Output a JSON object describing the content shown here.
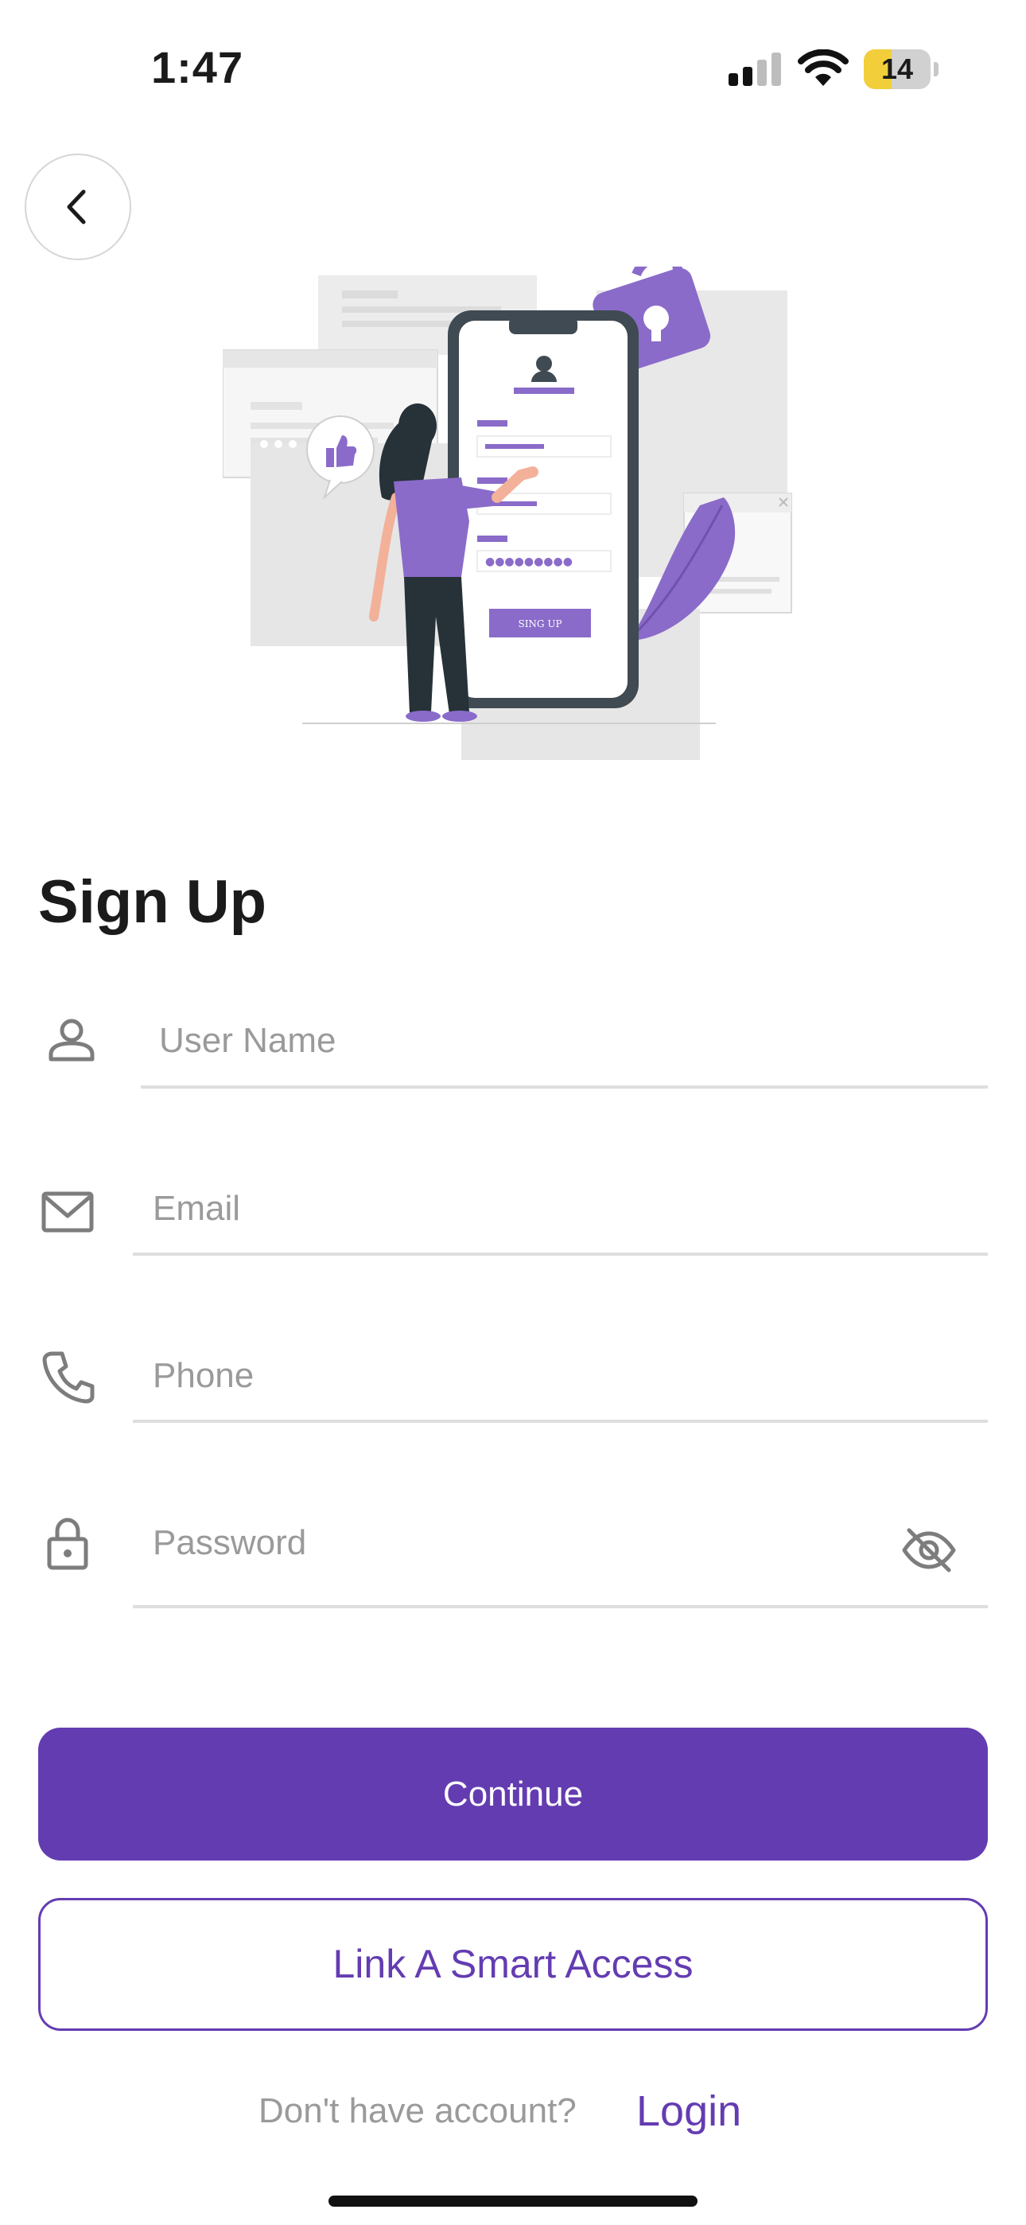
{
  "status_bar": {
    "time": "1:47",
    "battery_percent": "14",
    "battery_level": 0.14,
    "icons": [
      "cellular-signal-icon",
      "wifi-icon",
      "battery-icon"
    ]
  },
  "header": {
    "back_icon": "chevron-left-icon"
  },
  "illustration": {
    "button_text": "SING UP"
  },
  "title": "Sign Up",
  "form": {
    "username": {
      "placeholder": "User Name",
      "icon": "user-icon"
    },
    "email": {
      "placeholder": "Email",
      "icon": "mail-icon"
    },
    "phone": {
      "placeholder": "Phone",
      "icon": "phone-icon"
    },
    "password": {
      "placeholder": "Password",
      "icon": "lock-icon",
      "toggle_icon": "eye-off-icon"
    }
  },
  "buttons": {
    "continue": "Continue",
    "smart_access": "Link A Smart Access"
  },
  "footer": {
    "prompt": "Don't have account?",
    "login": "Login"
  },
  "colors": {
    "primary": "#643cb1",
    "placeholder": "#9a9a9a",
    "divider": "#dedede",
    "battery_fill": "#f2cf3a"
  }
}
